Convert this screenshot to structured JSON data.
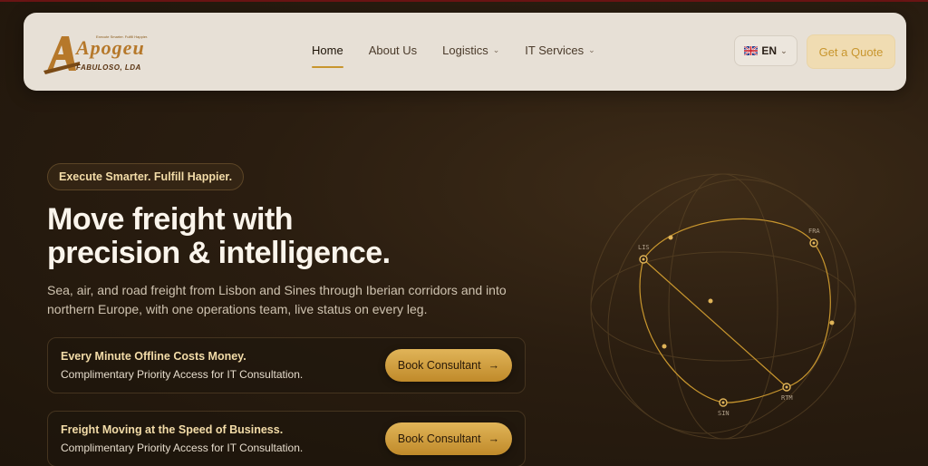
{
  "logo": {
    "name": "Apogeu",
    "subtitle": "FABULOSO, LDA",
    "tagline": "Execute Smarter. Fulfill Happier."
  },
  "nav": {
    "items": [
      {
        "label": "Home",
        "active": true,
        "dropdown": false
      },
      {
        "label": "About Us",
        "active": false,
        "dropdown": false
      },
      {
        "label": "Logistics",
        "active": false,
        "dropdown": true
      },
      {
        "label": "IT Services",
        "active": false,
        "dropdown": true
      }
    ]
  },
  "language": {
    "code": "EN",
    "flag": "uk-flag-icon"
  },
  "cta": {
    "quote_label": "Get a Quote"
  },
  "hero": {
    "pill": "Execute Smarter. Fulfill Happier.",
    "headline_line1": "Move freight with",
    "headline_line2": "precision & intelligence.",
    "description": "Sea, air, and road freight from Lisbon and Sines through Iberian corridors and into northern Europe, with one operations team, live status on every leg."
  },
  "cards": [
    {
      "title": "Every Minute Offline Costs Money.",
      "subtitle": "Complimentary Priority Access for IT Consultation.",
      "button": "Book Consultant"
    },
    {
      "title": "Freight Moving at the Speed of Business.",
      "subtitle": "Complimentary Priority Access for IT Consultation.",
      "button": "Book Consultant"
    }
  ],
  "map": {
    "nodes": [
      "LIS",
      "FRA",
      "RTM",
      "SIN"
    ]
  },
  "colors": {
    "accent": "#c8962e",
    "background": "#2a1d10",
    "header": "#e7e0d6"
  }
}
